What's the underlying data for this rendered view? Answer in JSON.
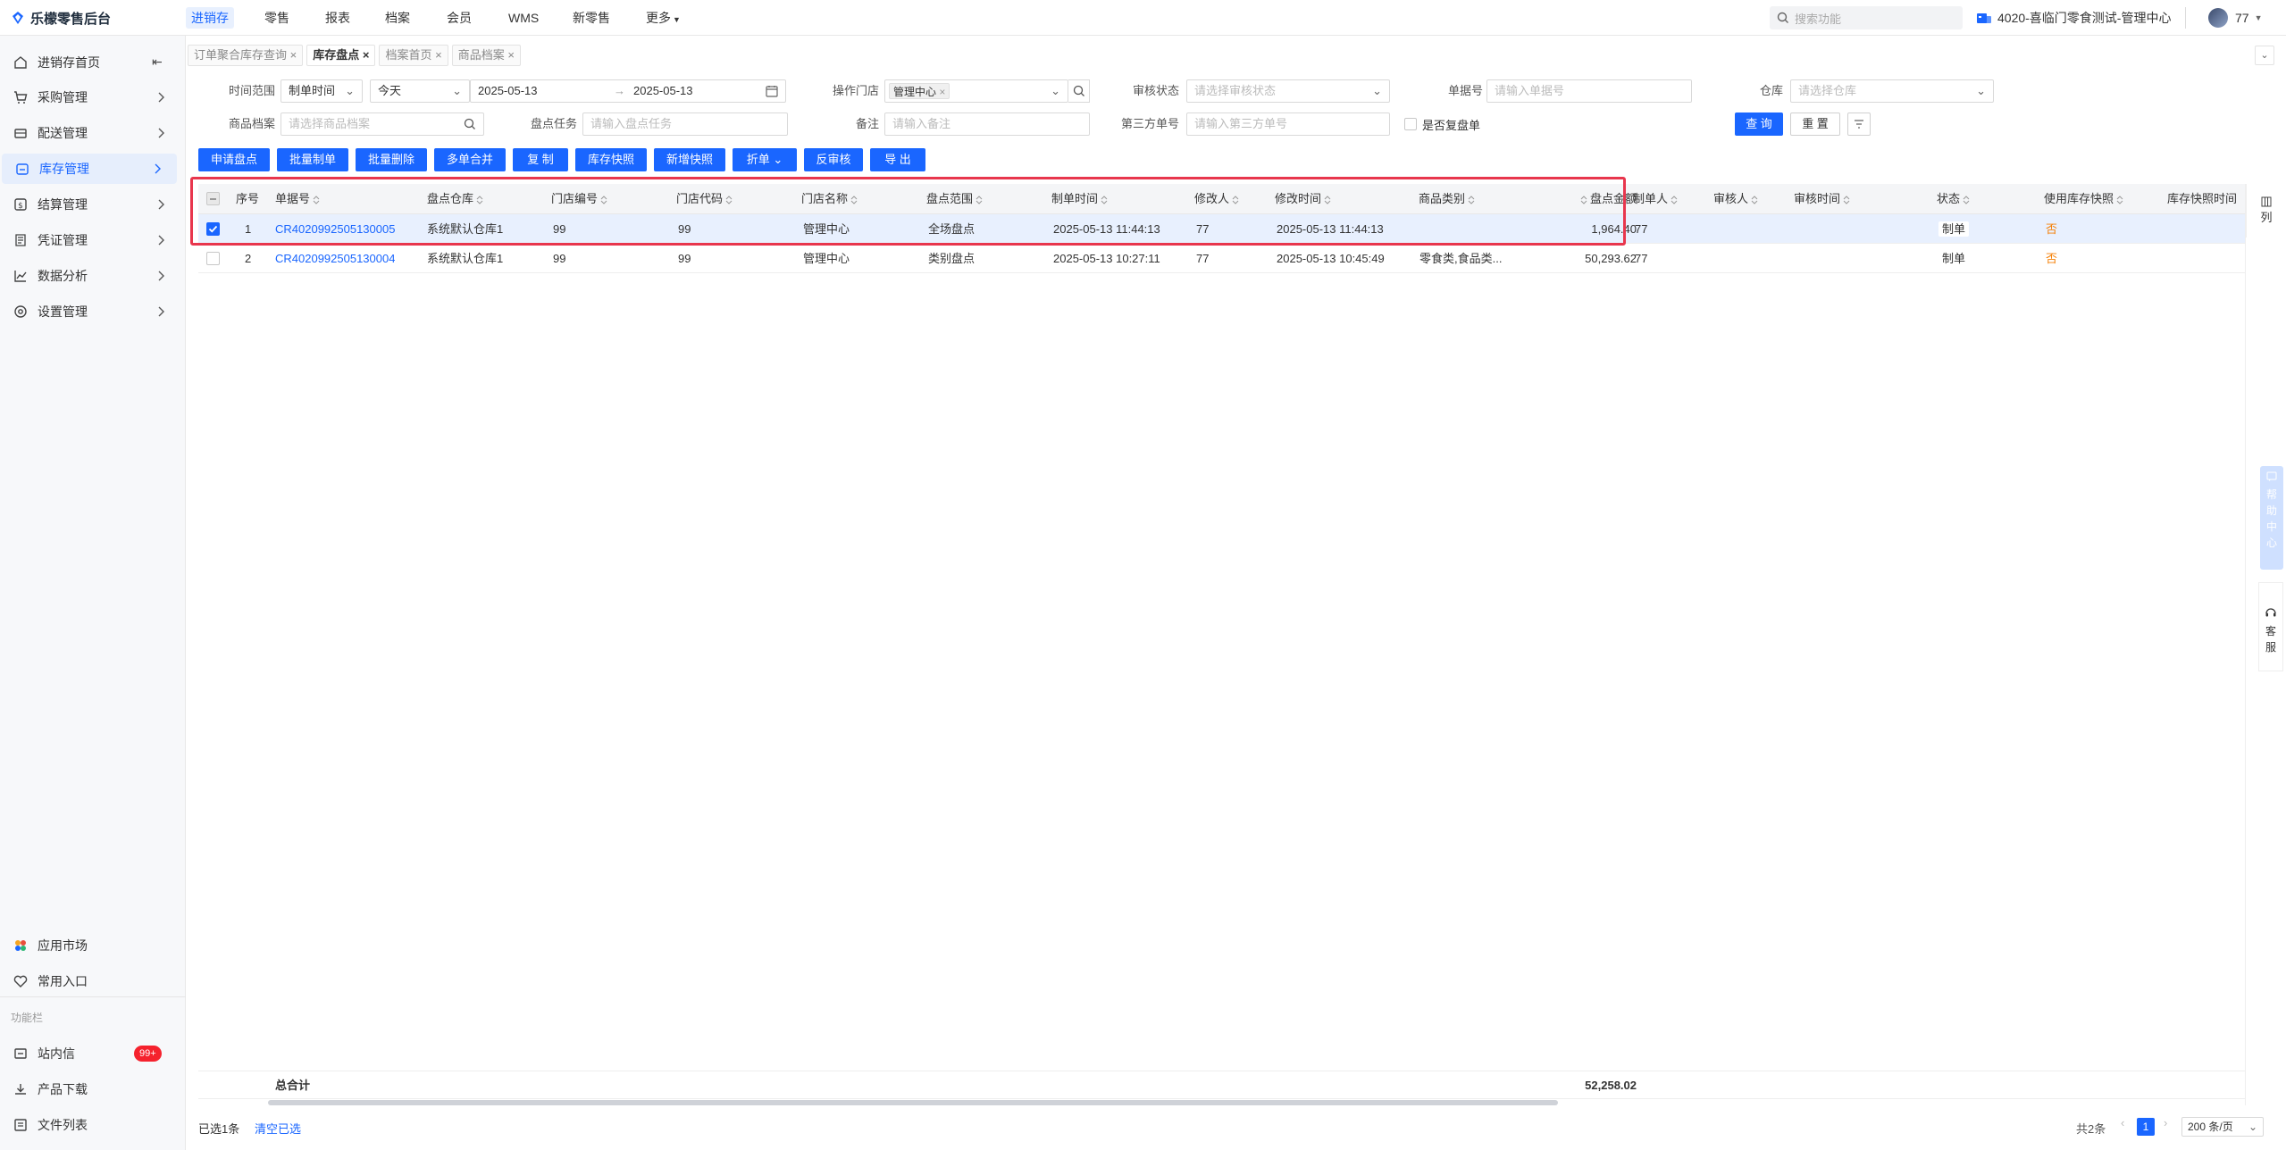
{
  "app": {
    "name": "乐檬零售后台"
  },
  "nav": {
    "tabs": [
      "进销存",
      "零售",
      "报表",
      "档案",
      "会员",
      "WMS",
      "新零售",
      "更多"
    ],
    "active": "进销存"
  },
  "header": {
    "search_placeholder": "搜索功能",
    "store": "4020-喜临门零食测试-管理中心",
    "user": "77"
  },
  "sidebar": {
    "items": [
      "进销存首页",
      "采购管理",
      "配送管理",
      "库存管理",
      "结算管理",
      "凭证管理",
      "数据分析",
      "设置管理"
    ],
    "active": "库存管理",
    "bottom_items": [
      "应用市场",
      "常用入口"
    ],
    "section_label": "功能栏",
    "func_items": [
      "站内信",
      "产品下载",
      "文件列表"
    ],
    "badge": "99+"
  },
  "page_tabs": [
    "订单聚合库存查询",
    "库存盘点",
    "档案首页",
    "商品档案"
  ],
  "active_tab": "库存盘点",
  "filters": {
    "time_range_label": "时间范围",
    "time_type": "制单时间",
    "period": "今天",
    "date_from": "2025-05-13",
    "date_to": "2025-05-13",
    "op_store_label": "操作门店",
    "op_store_tag": "管理中心",
    "audit_label": "审核状态",
    "audit_ph": "请选择审核状态",
    "doc_no_label": "单据号",
    "doc_no_ph": "请输入单据号",
    "warehouse_label": "仓库",
    "warehouse_ph": "请选择仓库",
    "goods_label": "商品档案",
    "goods_ph": "请选择商品档案",
    "task_label": "盘点任务",
    "task_ph": "请输入盘点任务",
    "remark_label": "备注",
    "remark_ph": "请输入备注",
    "third_label": "第三方单号",
    "third_ph": "请输入第三方单号",
    "recheck_label": "是否复盘单",
    "query": "查 询",
    "reset": "重 置"
  },
  "actions": [
    "申请盘点",
    "批量制单",
    "批量删除",
    "多单合并",
    "复 制",
    "库存快照",
    "新增快照",
    "折单",
    "反审核",
    "导 出"
  ],
  "table": {
    "columns": [
      "序号",
      "单据号",
      "盘点仓库",
      "门店编号",
      "门店代码",
      "门店名称",
      "盘点范围",
      "制单时间",
      "修改人",
      "修改时间",
      "商品类别",
      "盘点金额",
      "制单人",
      "审核人",
      "审核时间",
      "状态",
      "使用库存快照",
      "库存快照时间"
    ],
    "rows": [
      {
        "no": "1",
        "doc": "CR4020992505130005",
        "wh": "系统默认仓库1",
        "store_no": "99",
        "store_code": "99",
        "store_name": "管理中心",
        "scope": "全场盘点",
        "created": "2025-05-13 11:44:13",
        "modifier": "77",
        "modified": "2025-05-13 11:44:13",
        "category": "",
        "amount": "1,964.40",
        "creator": "77",
        "auditor": "",
        "audit_time": "",
        "status": "制单",
        "snapshot": "否",
        "snap_time": ""
      },
      {
        "no": "2",
        "doc": "CR4020992505130004",
        "wh": "系统默认仓库1",
        "store_no": "99",
        "store_code": "99",
        "store_name": "管理中心",
        "scope": "类别盘点",
        "created": "2025-05-13 10:27:11",
        "modifier": "77",
        "modified": "2025-05-13 10:45:49",
        "category": "零食类,食品类...",
        "amount": "50,293.62",
        "creator": "77",
        "auditor": "",
        "audit_time": "",
        "status": "制单",
        "snapshot": "否",
        "snap_time": ""
      }
    ],
    "total_label": "总合计",
    "total_amount": "52,258.02",
    "column_setting": "列"
  },
  "footer": {
    "selected": "已选1条",
    "clear": "清空已选",
    "total": "共2条",
    "page": "1",
    "page_size": "200 条/页"
  },
  "side_widgets": {
    "help": "帮助中心",
    "kefu": "客服"
  }
}
